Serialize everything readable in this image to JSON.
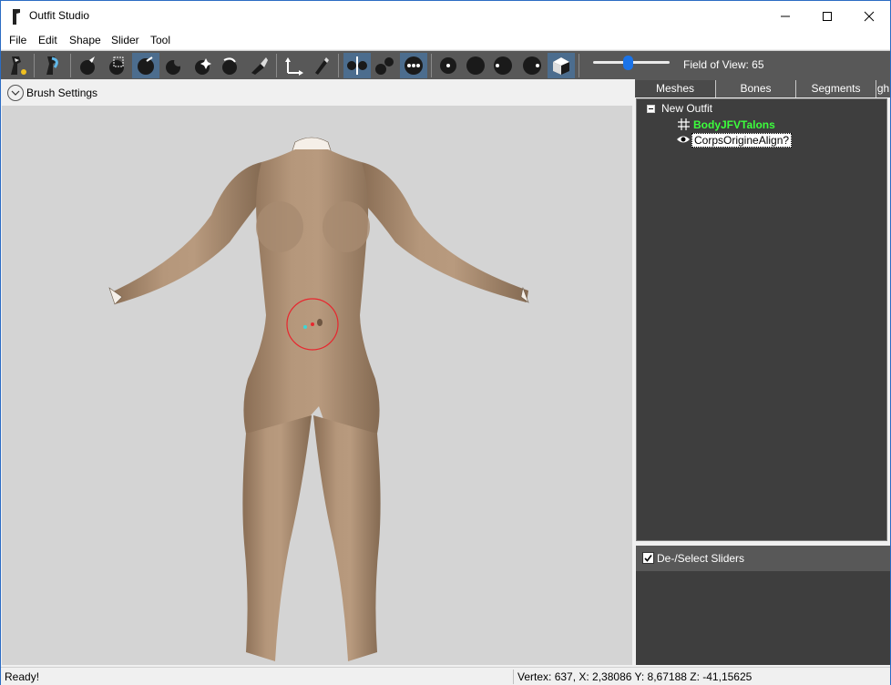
{
  "window": {
    "title": "Outfit Studio"
  },
  "menu": [
    "File",
    "Edit",
    "Shape",
    "Slider",
    "Tool"
  ],
  "toolbar": {
    "field_of_view_label": "Field of View: 65",
    "field_of_view": 65,
    "slider_fraction": 0.45
  },
  "viewport": {
    "brush_settings_label": "Brush Settings",
    "background_color": "#d4d4d4",
    "brush_color": "#e8262e"
  },
  "right_panel": {
    "tabs": [
      "Meshes",
      "Bones",
      "Segments",
      "gh"
    ],
    "active_tab": "Meshes",
    "tree": {
      "root": "New Outfit",
      "items": [
        {
          "label": "BodyJFVTalons",
          "icon": "grid-icon",
          "color": "#3cff3c"
        },
        {
          "label": "CorpsOrigineAlign?",
          "icon": "eye-icon"
        }
      ]
    },
    "sliders_label": "De-/Select Sliders"
  },
  "status": {
    "left": "Ready!",
    "right": "Vertex: 637, X: 2,38086 Y: 8,67188 Z: -41,15625"
  }
}
